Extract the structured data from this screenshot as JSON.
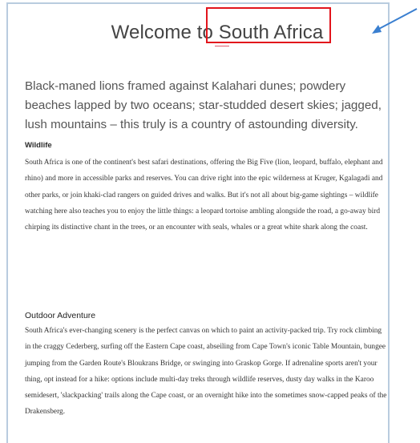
{
  "page": {
    "title": "Welcome to South Africa",
    "intro": "Black-maned lions framed against Kalahari dunes; powdery beaches lapped by two oceans; star-studded desert skies; jagged, lush mountains – this truly is a country of astounding diversity."
  },
  "sections": [
    {
      "heading": "Wildlife",
      "body": "South Africa is one of the continent's best safari destinations, offering the Big Five (lion, leopard, buffalo, elephant and rhino) and more in accessible parks and reserves. You can drive right into the epic wilderness at Kruger, Kgalagadi and other parks, or join khaki-clad rangers on guided drives and walks. But it's not all about big-game sightings – wildlife watching here also teaches you to enjoy the little things: a leopard tortoise ambling alongside the road, a go-away bird chirping its distinctive chant in the trees, or an encounter with seals, whales or a great white shark along the coast."
    },
    {
      "heading": "Outdoor Adventure",
      "body": "South Africa's ever-changing scenery is the perfect canvas on which to paint an activity-packed trip. Try rock climbing in the craggy Cederberg, surfing off the Eastern Cape coast, abseiling from Cape Town's iconic Table Mountain, bungee jumping from the Garden Route's Bloukrans Bridge, or swinging into Graskop Gorge. If adrenaline sports aren't your thing, opt instead for a hike: options include multi-day treks through wildlife reserves, dusty day walks in the Karoo semidesert, 'slackpacking' trails along the Cape coast, or an overnight hike into the sometimes snow-capped peaks of the Drakensberg."
    }
  ],
  "annotations": {
    "highlight_color": "#e2141c",
    "arrow_color": "#3a7fd0",
    "panel_border_color": "#b9ccdf",
    "accent_underline_color": "#e05a6b"
  }
}
